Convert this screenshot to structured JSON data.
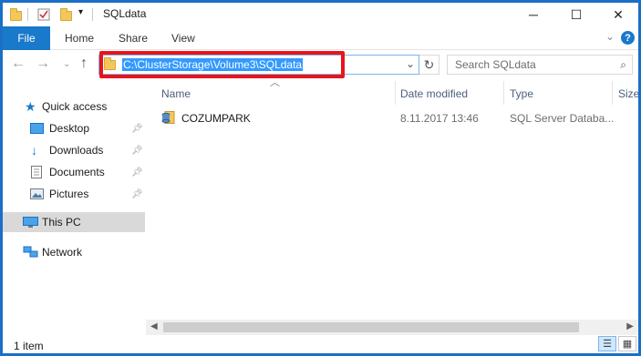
{
  "window": {
    "title": "SQLdata",
    "minimize": "─",
    "maximize": "☐",
    "close": "✕"
  },
  "ribbon": {
    "file_tab": "File",
    "tabs": [
      "Home",
      "Share",
      "View"
    ]
  },
  "address_bar": {
    "path": "C:\\ClusterStorage\\Volume3\\SQLdata"
  },
  "search": {
    "placeholder": "Search SQLdata"
  },
  "sidebar": {
    "quick_access": "Quick access",
    "pinned": [
      "Desktop",
      "Downloads",
      "Documents",
      "Pictures"
    ],
    "this_pc": "This PC",
    "network": "Network"
  },
  "columns": [
    "Name",
    "Date modified",
    "Type",
    "Size"
  ],
  "files": [
    {
      "name": "COZUMPARK",
      "date_modified": "8.11.2017 13:46",
      "type": "SQL Server Databa..."
    }
  ],
  "status": {
    "item_count": "1 item"
  },
  "colors": {
    "accent": "#1979ca",
    "frame": "#1c6fc6",
    "highlight_box": "#e8141b",
    "selection": "#3399ff"
  },
  "icons": {
    "back": "back-arrow-icon",
    "forward": "forward-arrow-icon",
    "up": "up-arrow-icon",
    "refresh": "refresh-icon",
    "search": "search-icon",
    "help": "help-icon"
  }
}
